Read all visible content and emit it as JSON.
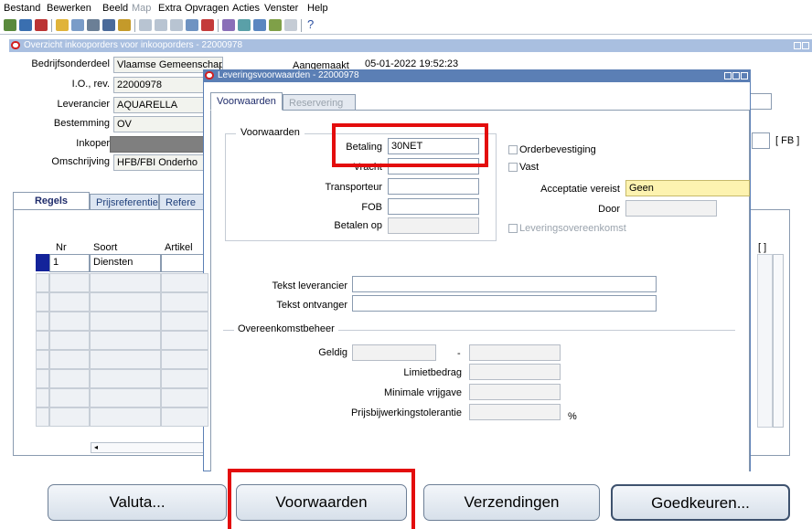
{
  "menu": [
    "Bestand",
    "Bewerken",
    "Beeld",
    "Map",
    "Extra",
    "Opvragen",
    "Acties",
    "Venster",
    "Help"
  ],
  "toolbar_help": "?",
  "back_window": {
    "title": "Overzicht inkooporders voor inkooporders - 22000978",
    "bedrijfsonderdeel_label": "Bedrijfsonderdeel",
    "bedrijfsonderdeel_value": "Vlaamse Gemeenschap",
    "io_label": "I.O., rev.",
    "io_value": "22000978",
    "leverancier_label": "Leverancier",
    "leverancier_value": "AQUARELLA",
    "bestemming_label": "Bestemming",
    "bestemming_value": "OV",
    "inkoper_label": "Inkoper",
    "omschrijving_label": "Omschrijving",
    "omschrijving_value": "HFB/FBI Onderho",
    "aangemaakt_label": "Aangemaakt",
    "aangemaakt_value": "05-01-2022 19:52:23",
    "fb_tag": "[ FB ]",
    "tabs": [
      "Regels",
      "Prijsreferentie",
      "Refere"
    ],
    "columns": {
      "nr": "Nr",
      "soort": "Soort",
      "artikel": "Artikel"
    },
    "row1": {
      "nr": "1",
      "soort": "Diensten"
    },
    "bracket": "[ ]"
  },
  "dialog": {
    "title": "Leveringsvoorwaarden - 22000978",
    "tabs": [
      "Voorwaarden",
      "Reservering"
    ],
    "group_title": "Voorwaarden",
    "betaling_label": "Betaling",
    "betaling_value": "30NET",
    "vracht_label": "Vracht",
    "transporteur_label": "Transporteur",
    "fob_label": "FOB",
    "betalen_op_label": "Betalen op",
    "orderbevestiging_label": "Orderbevestiging",
    "vast_label": "Vast",
    "acceptatie_label": "Acceptatie vereist",
    "acceptatie_value": "Geen",
    "door_label": "Door",
    "leveringsovereenkomst_label": "Leveringsovereenkomst",
    "tekst_leverancier_label": "Tekst leverancier",
    "tekst_ontvanger_label": "Tekst ontvanger",
    "overeenkomst_title": "Overeenkomstbeheer",
    "geldig_label": "Geldig",
    "geldig_sep": "-",
    "limietbedrag_label": "Limietbedrag",
    "minimale_label": "Minimale vrijgave",
    "prijsbijwerking_label": "Prijsbijwerkingstolerantie",
    "percent": "%"
  },
  "buttons": {
    "valuta": "Valuta...",
    "voorwaarden": "Voorwaarden",
    "verzendingen": "Verzendingen",
    "goedkeuren": "Goedkeuren..."
  },
  "colors": {
    "title_active": "#5b7fb5",
    "title_inactive": "#a9bfe0",
    "highlight": "#e30d0d",
    "field_required": "#fdf3b0"
  }
}
